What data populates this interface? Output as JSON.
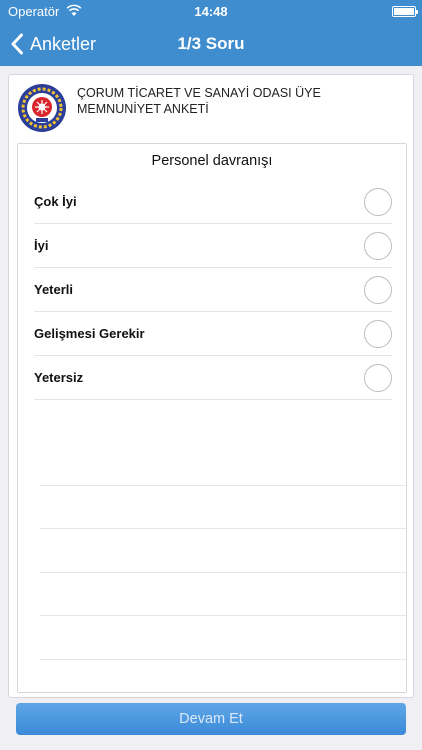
{
  "status_bar": {
    "carrier": "Operatör",
    "time": "14:48"
  },
  "nav": {
    "back_label": "Anketler",
    "title": "1/3 Soru"
  },
  "survey": {
    "title": "ÇORUM TİCARET VE SANAYİ ODASI ÜYE MEMNUNİYET ANKETİ"
  },
  "question": {
    "text": "Personel davranışı",
    "options": [
      "Çok İyi",
      "İyi",
      "Yeterli",
      "Gelişmesi Gerekir",
      "Yetersiz"
    ]
  },
  "footer": {
    "continue_label": "Devam Et"
  },
  "colors": {
    "accent": "#3f8ccf",
    "button": "#4a98de"
  }
}
